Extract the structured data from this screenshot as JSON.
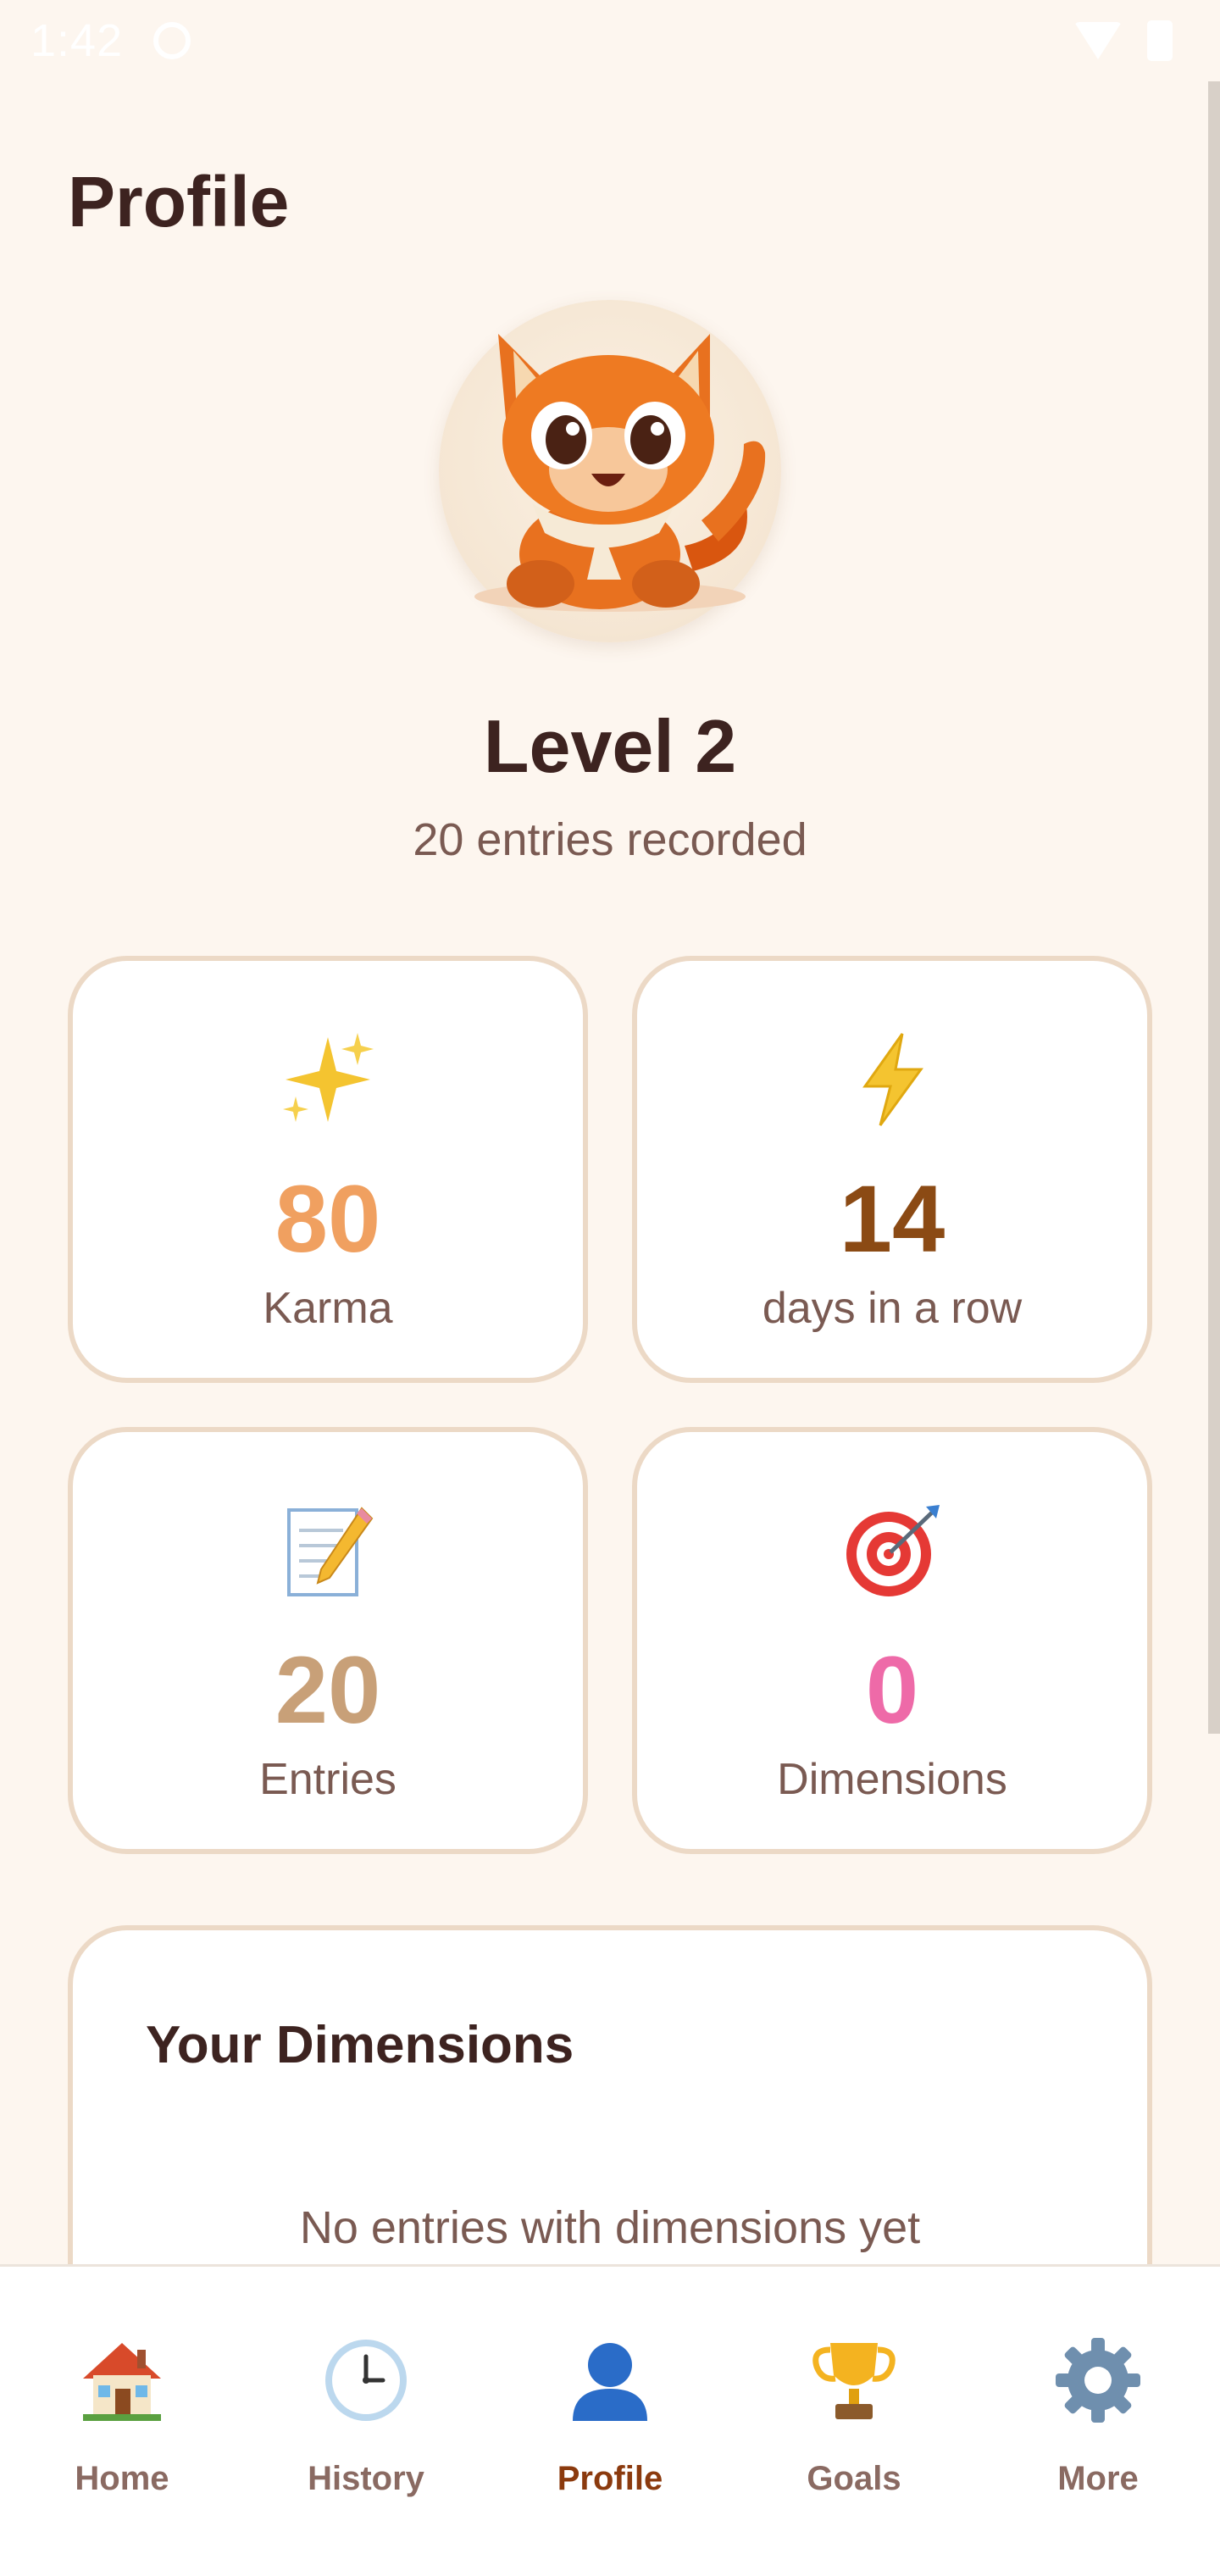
{
  "status_bar": {
    "time": "1:42"
  },
  "header": {
    "title": "Profile"
  },
  "profile": {
    "level": "Level 2",
    "entries_recorded": "20 entries recorded"
  },
  "stats": [
    {
      "icon": "sparkles-icon",
      "value": "80",
      "label": "Karma",
      "color": "#f0a060"
    },
    {
      "icon": "lightning-icon",
      "value": "14",
      "label": "days in a row",
      "color": "#8b4a14"
    },
    {
      "icon": "memo-icon",
      "value": "20",
      "label": "Entries",
      "color": "#c8a078"
    },
    {
      "icon": "target-icon",
      "value": "0",
      "label": "Dimensions",
      "color": "#ee6aa8"
    }
  ],
  "dimensions_card": {
    "title": "Your Dimensions",
    "empty_text": "No entries with dimensions yet"
  },
  "bottom_nav": {
    "active": "Profile",
    "items": [
      {
        "label": "Home",
        "icon": "house-icon"
      },
      {
        "label": "History",
        "icon": "clock-icon"
      },
      {
        "label": "Profile",
        "icon": "person-icon"
      },
      {
        "label": "Goals",
        "icon": "trophy-icon"
      },
      {
        "label": "More",
        "icon": "gear-icon"
      }
    ]
  },
  "colors": {
    "background": "#fdf6ef",
    "card_border": "#ecd9c6",
    "title_text": "#3d2320",
    "secondary_text": "#7a5a52",
    "nav_active": "#8b3a0e"
  }
}
